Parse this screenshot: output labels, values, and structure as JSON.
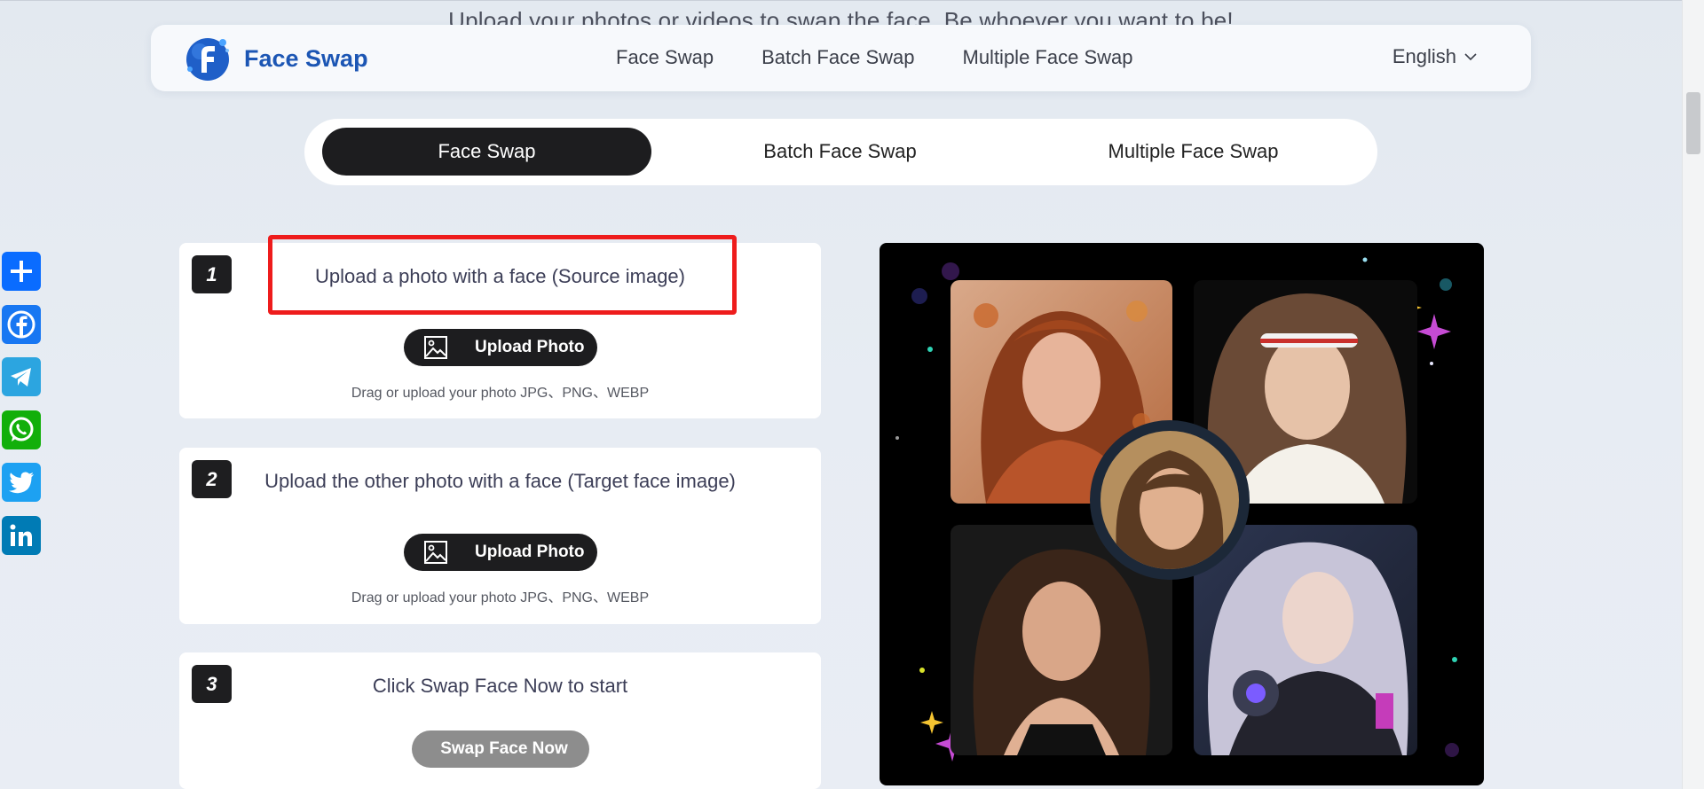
{
  "page": {
    "partial_heading": "Upload your photos or videos to swap the face. Be whoever you want to be!"
  },
  "header": {
    "brand_name": "Face Swap",
    "nav": [
      "Face Swap",
      "Batch Face Swap",
      "Multiple Face Swap"
    ],
    "language": "English"
  },
  "tabs": {
    "items": [
      "Face Swap",
      "Batch Face Swap",
      "Multiple Face Swap"
    ],
    "active": "Face Swap"
  },
  "share": {
    "icons": [
      "share-plus-icon",
      "facebook-icon",
      "telegram-icon",
      "whatsapp-icon",
      "twitter-icon",
      "linkedin-icon"
    ]
  },
  "steps": [
    {
      "number": "1",
      "title": "Upload a photo with a face (Source image)",
      "button": "Upload Photo",
      "hint": "Drag or upload your photo JPG、PNG、WEBP"
    },
    {
      "number": "2",
      "title": "Upload the other photo with a face (Target face image)",
      "button": "Upload Photo",
      "hint": "Drag or upload your photo JPG、PNG、WEBP"
    },
    {
      "number": "3",
      "title": "Click Swap Face Now to start",
      "button": "Swap Face Now"
    }
  ],
  "colors": {
    "brand_blue": "#1c56b4",
    "dark_button": "#1d1d1f",
    "disabled_button": "#8d8d8d",
    "highlight_red": "#ee1c1c",
    "background": "#e6ebf2"
  }
}
